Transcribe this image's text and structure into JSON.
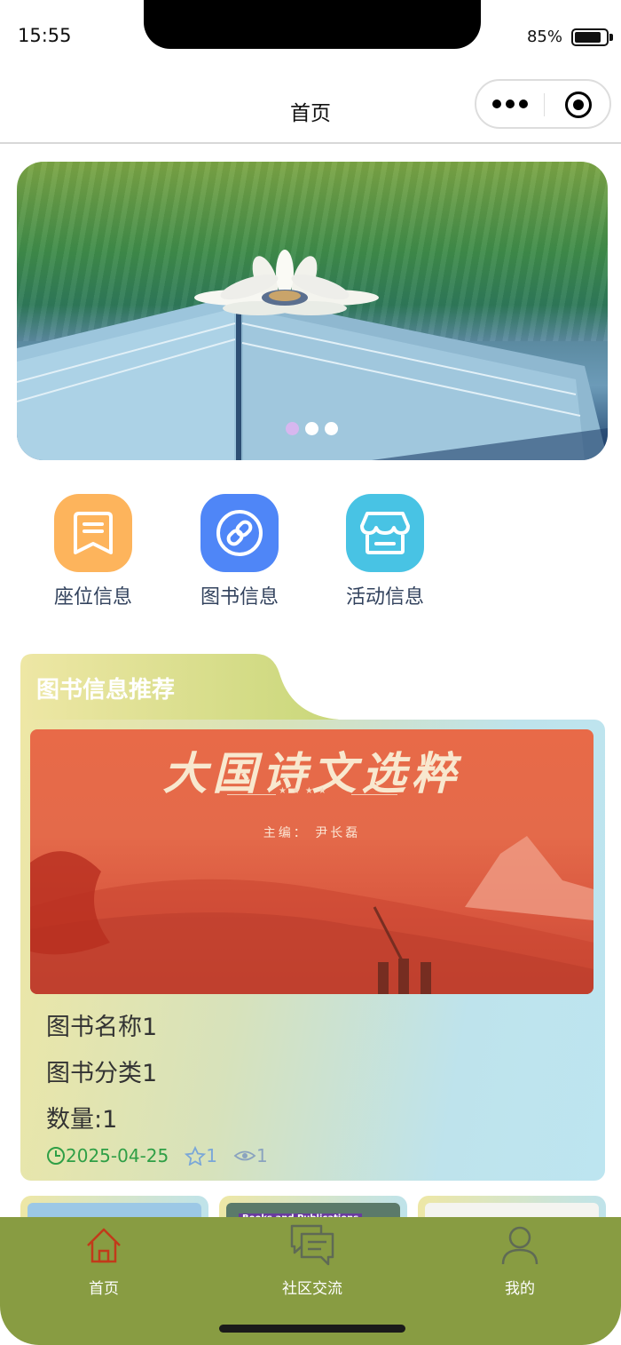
{
  "status_bar": {
    "time": "15:55",
    "battery": "85%",
    "battery_level": 0.85
  },
  "nav": {
    "title": "首页",
    "more_icon": "more-dots-icon",
    "close_icon": "target-icon"
  },
  "banner": {
    "slide_count": 3,
    "active_index": 0
  },
  "quick_menu": [
    {
      "label": "座位信息",
      "icon": "bookmark-list-icon",
      "color": "#fdb45c"
    },
    {
      "label": "图书信息",
      "icon": "link-icon",
      "color": "#4f86f7"
    },
    {
      "label": "活动信息",
      "icon": "store-icon",
      "color": "#48c3e4"
    }
  ],
  "recommend": {
    "title": "图书信息推荐",
    "featured": {
      "cover_title": "大国诗文选粹",
      "cover_editor": "主编： 尹长磊",
      "name": "图书名称1",
      "category": "图书分类1",
      "quantity": "数量:1",
      "date": "2025-04-25",
      "stars": "1",
      "views": "1"
    },
    "mini_cards": [
      {
        "title": ""
      },
      {
        "title": "Books and Publications"
      },
      {
        "title": ""
      }
    ]
  },
  "tabbar": {
    "items": [
      {
        "label": "首页",
        "icon": "home-icon",
        "active": true
      },
      {
        "label": "社区交流",
        "icon": "chat-icon",
        "active": false
      },
      {
        "label": "我的",
        "icon": "user-icon",
        "active": false
      }
    ],
    "bg_color": "#889c42",
    "active_color": "#c23a1a"
  }
}
